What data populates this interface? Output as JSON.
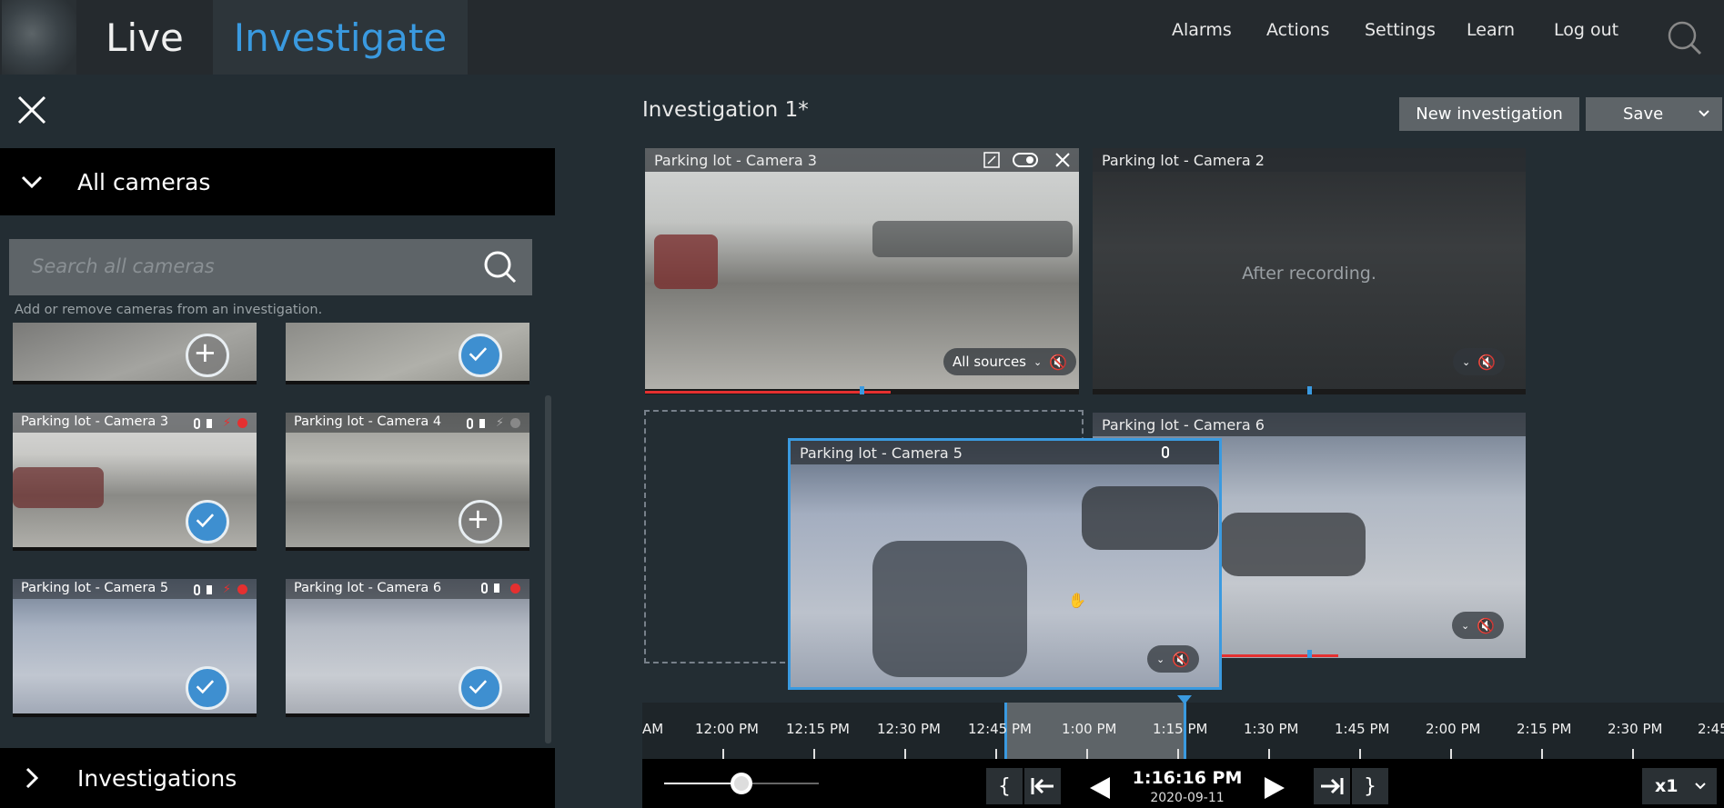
{
  "nav": {
    "live_label": "Live",
    "investigate_label": "Investigate",
    "menu": [
      "Alarms",
      "Actions",
      "Settings",
      "Learn",
      "Log out"
    ]
  },
  "left": {
    "all_cameras_label": "All cameras",
    "search_placeholder": "Search all cameras",
    "hint": "Add or remove cameras from an investigation.",
    "investigations_label": "Investigations",
    "thumbs": [
      {
        "title": "",
        "state": "add"
      },
      {
        "title": "",
        "state": "checked"
      },
      {
        "title": "Parking lot - Camera 3",
        "state": "checked"
      },
      {
        "title": "Parking lot - Camera 4",
        "state": "add"
      },
      {
        "title": "Parking lot - Camera 5",
        "state": "checked"
      },
      {
        "title": "Parking lot - Camera 6",
        "state": "checked"
      }
    ]
  },
  "main": {
    "investigation_title": "Investigation 1*",
    "new_investigation_label": "New investigation",
    "save_label": "Save",
    "tiles": [
      {
        "title": "Parking lot - Camera 3",
        "source_label": "All sources"
      },
      {
        "title": "Parking lot - Camera 2",
        "overlay": "After recording."
      },
      {
        "title": "Parking lot - Camera 6"
      },
      {
        "title": "Parking lot - Camera 5"
      }
    ]
  },
  "timeline": {
    "labels": [
      "AM",
      "12:00 PM",
      "12:15 PM",
      "12:30 PM",
      "12:45 PM",
      "1:00 PM",
      "1:15 PM",
      "1:30 PM",
      "1:45 PM",
      "2:00 PM",
      "2:15 PM",
      "2:30 PM",
      "2:45"
    ],
    "current_time": "1:16:16 PM",
    "current_date": "2020-09-11",
    "speed": "x1",
    "zoom_level": 0.5
  },
  "colors": {
    "accent": "#3a9ae0",
    "recording": "#e53030",
    "topbar": "#252a2e"
  }
}
